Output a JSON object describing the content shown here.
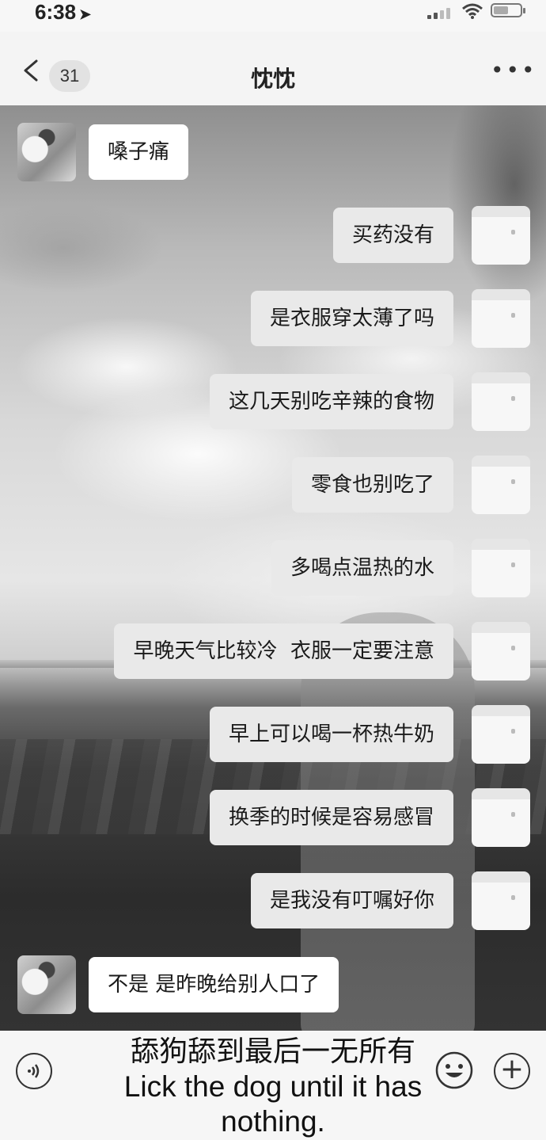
{
  "status_bar": {
    "time": "6:38",
    "location_arrow": "➤"
  },
  "header": {
    "back_count": "31",
    "title": "忱忱",
    "more": "•••"
  },
  "messages": [
    {
      "side": "left",
      "text": "嗓子痛"
    },
    {
      "side": "right",
      "text": "买药没有"
    },
    {
      "side": "right",
      "text": "是衣服穿太薄了吗"
    },
    {
      "side": "right",
      "text": "这几天别吃辛辣的食物"
    },
    {
      "side": "right",
      "text": "零食也别吃了"
    },
    {
      "side": "right",
      "text": "多喝点温热的水"
    },
    {
      "side": "right",
      "text": "早晚天气比较冷  衣服一定要注意"
    },
    {
      "side": "right",
      "text": "早上可以喝一杯热牛奶"
    },
    {
      "side": "right",
      "text": "换季的时候是容易感冒"
    },
    {
      "side": "right",
      "text": "是我没有叮嘱好你"
    },
    {
      "side": "left",
      "text": "不是 是昨晚给别人口了"
    }
  ],
  "caption": {
    "chinese": "舔狗舔到最后一无所有",
    "english_line1": "Lick the dog until it has",
    "english_line2": "nothing."
  },
  "icons": [
    "location-arrow-icon",
    "signal-icon",
    "wifi-icon",
    "battery-icon",
    "back-chevron-icon",
    "more-icon",
    "voice-icon",
    "emoji-icon",
    "plus-icon"
  ],
  "colors": {
    "left_bubble": "#ffffff",
    "right_bubble": "#e9e9e9",
    "background": "#f4f4f4"
  }
}
